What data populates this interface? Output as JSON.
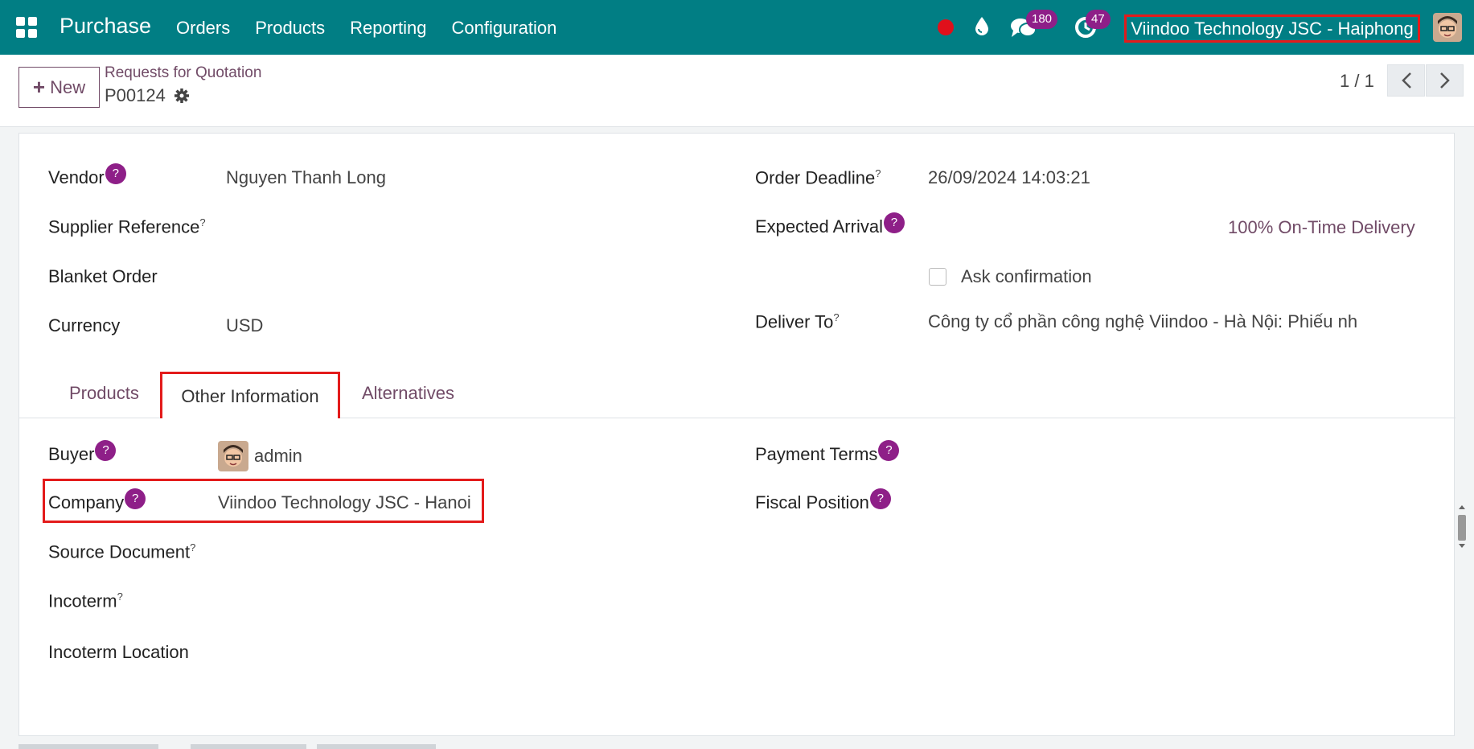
{
  "navbar": {
    "app_name": "Purchase",
    "menu": [
      "Orders",
      "Products",
      "Reporting",
      "Configuration"
    ],
    "chat_count": "180",
    "activity_count": "47",
    "company": "Viindoo Technology JSC - Haiphong",
    "icons": [
      "apps-icon",
      "record-icon",
      "drop-icon",
      "chat-icon",
      "clock-icon",
      "user-avatar"
    ],
    "accent_color": "#017e84"
  },
  "control": {
    "new_label": "New",
    "breadcrumb": "Requests for Quotation",
    "record": "P00124",
    "pager": "1 / 1"
  },
  "form": {
    "vendor_label": "Vendor",
    "vendor_value": "Nguyen Thanh Long",
    "supplier_ref_label": "Supplier Reference",
    "blanket_label": "Blanket Order",
    "currency_label": "Currency",
    "currency_value": "USD",
    "deadline_label": "Order Deadline",
    "deadline_value": "26/09/2024 14:03:21",
    "arrival_label": "Expected Arrival",
    "ontime_label": "100% On-Time Delivery",
    "ask_confirmation_label": "Ask confirmation",
    "deliver_label": "Deliver To",
    "deliver_value": "Công ty cổ phần công nghệ Viindoo - Hà Nội: Phiếu nh"
  },
  "tabs": {
    "products": "Products",
    "other": "Other Information",
    "alternatives": "Alternatives"
  },
  "other": {
    "buyer_label": "Buyer",
    "buyer_value": "admin",
    "company_label": "Company",
    "company_value": "Viindoo Technology JSC - Hanoi",
    "source_label": "Source Document",
    "incoterm_label": "Incoterm",
    "incoterm_location_label": "Incoterm Location",
    "payment_terms_label": "Payment Terms",
    "fiscal_label": "Fiscal Position"
  },
  "question_mark": "?"
}
